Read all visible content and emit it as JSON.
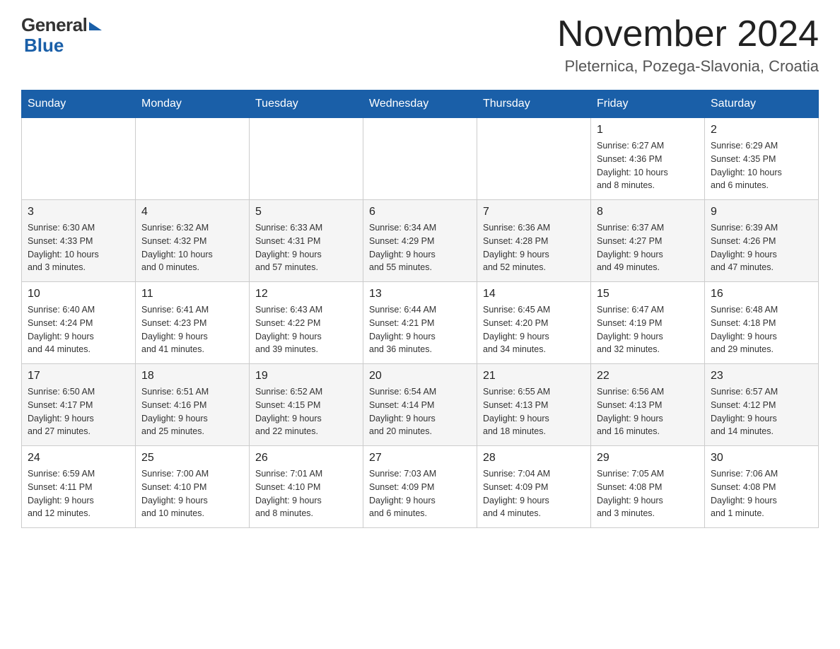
{
  "header": {
    "logo_general": "General",
    "logo_blue": "Blue",
    "month_year": "November 2024",
    "location": "Pleternica, Pozega-Slavonia, Croatia"
  },
  "calendar": {
    "days_of_week": [
      "Sunday",
      "Monday",
      "Tuesday",
      "Wednesday",
      "Thursday",
      "Friday",
      "Saturday"
    ],
    "weeks": [
      {
        "days": [
          {
            "number": "",
            "info": ""
          },
          {
            "number": "",
            "info": ""
          },
          {
            "number": "",
            "info": ""
          },
          {
            "number": "",
            "info": ""
          },
          {
            "number": "",
            "info": ""
          },
          {
            "number": "1",
            "info": "Sunrise: 6:27 AM\nSunset: 4:36 PM\nDaylight: 10 hours\nand 8 minutes."
          },
          {
            "number": "2",
            "info": "Sunrise: 6:29 AM\nSunset: 4:35 PM\nDaylight: 10 hours\nand 6 minutes."
          }
        ]
      },
      {
        "days": [
          {
            "number": "3",
            "info": "Sunrise: 6:30 AM\nSunset: 4:33 PM\nDaylight: 10 hours\nand 3 minutes."
          },
          {
            "number": "4",
            "info": "Sunrise: 6:32 AM\nSunset: 4:32 PM\nDaylight: 10 hours\nand 0 minutes."
          },
          {
            "number": "5",
            "info": "Sunrise: 6:33 AM\nSunset: 4:31 PM\nDaylight: 9 hours\nand 57 minutes."
          },
          {
            "number": "6",
            "info": "Sunrise: 6:34 AM\nSunset: 4:29 PM\nDaylight: 9 hours\nand 55 minutes."
          },
          {
            "number": "7",
            "info": "Sunrise: 6:36 AM\nSunset: 4:28 PM\nDaylight: 9 hours\nand 52 minutes."
          },
          {
            "number": "8",
            "info": "Sunrise: 6:37 AM\nSunset: 4:27 PM\nDaylight: 9 hours\nand 49 minutes."
          },
          {
            "number": "9",
            "info": "Sunrise: 6:39 AM\nSunset: 4:26 PM\nDaylight: 9 hours\nand 47 minutes."
          }
        ]
      },
      {
        "days": [
          {
            "number": "10",
            "info": "Sunrise: 6:40 AM\nSunset: 4:24 PM\nDaylight: 9 hours\nand 44 minutes."
          },
          {
            "number": "11",
            "info": "Sunrise: 6:41 AM\nSunset: 4:23 PM\nDaylight: 9 hours\nand 41 minutes."
          },
          {
            "number": "12",
            "info": "Sunrise: 6:43 AM\nSunset: 4:22 PM\nDaylight: 9 hours\nand 39 minutes."
          },
          {
            "number": "13",
            "info": "Sunrise: 6:44 AM\nSunset: 4:21 PM\nDaylight: 9 hours\nand 36 minutes."
          },
          {
            "number": "14",
            "info": "Sunrise: 6:45 AM\nSunset: 4:20 PM\nDaylight: 9 hours\nand 34 minutes."
          },
          {
            "number": "15",
            "info": "Sunrise: 6:47 AM\nSunset: 4:19 PM\nDaylight: 9 hours\nand 32 minutes."
          },
          {
            "number": "16",
            "info": "Sunrise: 6:48 AM\nSunset: 4:18 PM\nDaylight: 9 hours\nand 29 minutes."
          }
        ]
      },
      {
        "days": [
          {
            "number": "17",
            "info": "Sunrise: 6:50 AM\nSunset: 4:17 PM\nDaylight: 9 hours\nand 27 minutes."
          },
          {
            "number": "18",
            "info": "Sunrise: 6:51 AM\nSunset: 4:16 PM\nDaylight: 9 hours\nand 25 minutes."
          },
          {
            "number": "19",
            "info": "Sunrise: 6:52 AM\nSunset: 4:15 PM\nDaylight: 9 hours\nand 22 minutes."
          },
          {
            "number": "20",
            "info": "Sunrise: 6:54 AM\nSunset: 4:14 PM\nDaylight: 9 hours\nand 20 minutes."
          },
          {
            "number": "21",
            "info": "Sunrise: 6:55 AM\nSunset: 4:13 PM\nDaylight: 9 hours\nand 18 minutes."
          },
          {
            "number": "22",
            "info": "Sunrise: 6:56 AM\nSunset: 4:13 PM\nDaylight: 9 hours\nand 16 minutes."
          },
          {
            "number": "23",
            "info": "Sunrise: 6:57 AM\nSunset: 4:12 PM\nDaylight: 9 hours\nand 14 minutes."
          }
        ]
      },
      {
        "days": [
          {
            "number": "24",
            "info": "Sunrise: 6:59 AM\nSunset: 4:11 PM\nDaylight: 9 hours\nand 12 minutes."
          },
          {
            "number": "25",
            "info": "Sunrise: 7:00 AM\nSunset: 4:10 PM\nDaylight: 9 hours\nand 10 minutes."
          },
          {
            "number": "26",
            "info": "Sunrise: 7:01 AM\nSunset: 4:10 PM\nDaylight: 9 hours\nand 8 minutes."
          },
          {
            "number": "27",
            "info": "Sunrise: 7:03 AM\nSunset: 4:09 PM\nDaylight: 9 hours\nand 6 minutes."
          },
          {
            "number": "28",
            "info": "Sunrise: 7:04 AM\nSunset: 4:09 PM\nDaylight: 9 hours\nand 4 minutes."
          },
          {
            "number": "29",
            "info": "Sunrise: 7:05 AM\nSunset: 4:08 PM\nDaylight: 9 hours\nand 3 minutes."
          },
          {
            "number": "30",
            "info": "Sunrise: 7:06 AM\nSunset: 4:08 PM\nDaylight: 9 hours\nand 1 minute."
          }
        ]
      }
    ]
  }
}
